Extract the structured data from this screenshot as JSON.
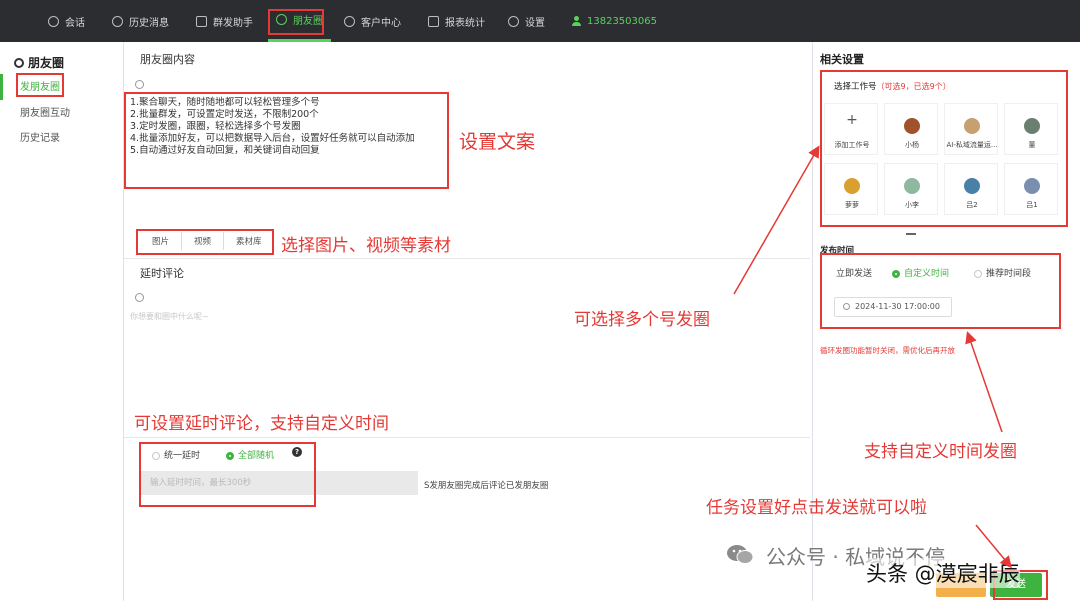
{
  "nav": {
    "items": [
      {
        "label": "会话",
        "icon": "chat-icon"
      },
      {
        "label": "历史消息",
        "icon": "clock-icon"
      },
      {
        "label": "群发助手",
        "icon": "send-icon"
      },
      {
        "label": "朋友圈",
        "icon": "moments-icon"
      },
      {
        "label": "客户中心",
        "icon": "customer-icon"
      },
      {
        "label": "报表统计",
        "icon": "chart-icon"
      },
      {
        "label": "设置",
        "icon": "gear-icon"
      }
    ],
    "active": "朋友圈",
    "user_phone": "13823503065"
  },
  "sidebar": {
    "title": "朋友圈",
    "items": [
      "发朋友圈",
      "朋友圈互动",
      "历史记录"
    ],
    "active": "发朋友圈"
  },
  "main": {
    "content_label": "朋友圈内容",
    "copy_lines": [
      "1.聚合聊天，随时随地都可以轻松管理多个号",
      "2.批量群发，可设置定时发送，不限制200个",
      "3.定时发圈，跟圈，轻松选择多个号发圈",
      "4.批量添加好友，可以把数据导入后台，设置好任务就可以自动添加",
      "5.自动通过好友自动回复，和关键词自动回复"
    ],
    "material_buttons": [
      "图片",
      "视频",
      "素材库"
    ],
    "delay_comment_label": "延时评论",
    "comment_placeholder": "你想要和圈中什么呢~",
    "delay_options": [
      "统一延时",
      "全部随机"
    ],
    "delay_selected": "全部随机",
    "delay_input_placeholder": "输入延时时间，最长300秒",
    "delay_note": "S发朋友圈完成后评论已发朋友圈"
  },
  "right": {
    "title": "相关设置",
    "account_label": "选择工作号",
    "account_hint": "（可选9，已选9个）",
    "accounts": [
      {
        "name": "添加工作号",
        "add": true
      },
      {
        "name": "小杨",
        "color": "#a0522d"
      },
      {
        "name": "AI-私域流量运...",
        "color": "#c8a070"
      },
      {
        "name": "董",
        "color": "#6a7f70"
      },
      {
        "name": "萝萝",
        "color": "#d9a030"
      },
      {
        "name": "小李",
        "color": "#8fb8a0"
      },
      {
        "name": "吕2",
        "color": "#4a7fa8"
      },
      {
        "name": "吕1",
        "color": "#7a8fb0"
      }
    ],
    "publish_label": "发布时间",
    "publish_options": [
      "立即发送",
      "自定义时间",
      "推荐时间段"
    ],
    "publish_selected": "自定义时间",
    "datetime": "2024-11-30 17:00:00",
    "red_note": "循环发圈功能暂时关闭，需优化后再开放",
    "send_label": "发送"
  },
  "annotations": {
    "copy": "设置文案",
    "material": "选择图片、视频等素材",
    "multi_account": "可选择多个号发圈",
    "delay": "可设置延时评论，支持自定义时间",
    "custom_time": "支持自定义时间发圈",
    "send_tip": "任务设置好点击发送就可以啦"
  },
  "watermark": {
    "account": "公众号 · 私域说不停",
    "toutiao": "头条 @漠宸非辰"
  },
  "colors": {
    "accent": "#3fb33f",
    "annotation": "#e53935",
    "topbar": "#2b2d31"
  }
}
